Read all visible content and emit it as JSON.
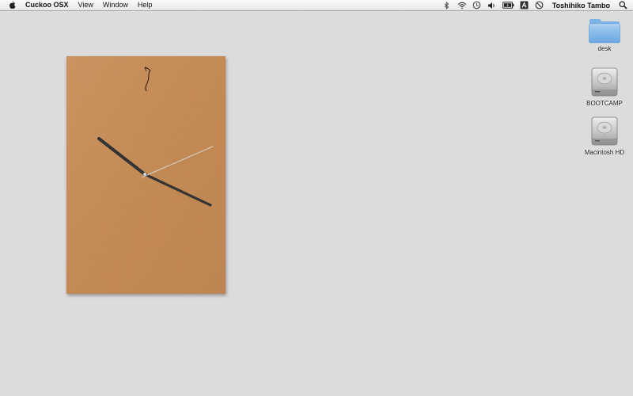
{
  "menubar": {
    "apple_icon": "apple-icon",
    "app_name": "Cuckoo OSX",
    "menus": [
      "View",
      "Window",
      "Help"
    ],
    "status_icons": [
      "bluetooth-icon",
      "wifi-icon",
      "time-machine-icon",
      "volume-icon",
      "battery-icon",
      "input-source-icon",
      "notification-icon"
    ],
    "user_name": "Toshihiko Tambo",
    "search_icon": "spotlight-search-icon"
  },
  "clock": {
    "face": "wooden-clock-face",
    "hour_hand": "hour-hand",
    "minute_hand": "minute-hand",
    "second_hand": "second-hand",
    "logo": "cuckoo-bird-logo",
    "colors": {
      "wood": "#c98d55",
      "hands": "#333333",
      "second_hand": "#d8d2c8"
    }
  },
  "desktop_icons": [
    {
      "label": "desk",
      "icon": "folder-icon"
    },
    {
      "label": "BOOTCAMP",
      "icon": "hard-drive-icon"
    },
    {
      "label": "Macintosh HD",
      "icon": "hard-drive-icon"
    }
  ]
}
